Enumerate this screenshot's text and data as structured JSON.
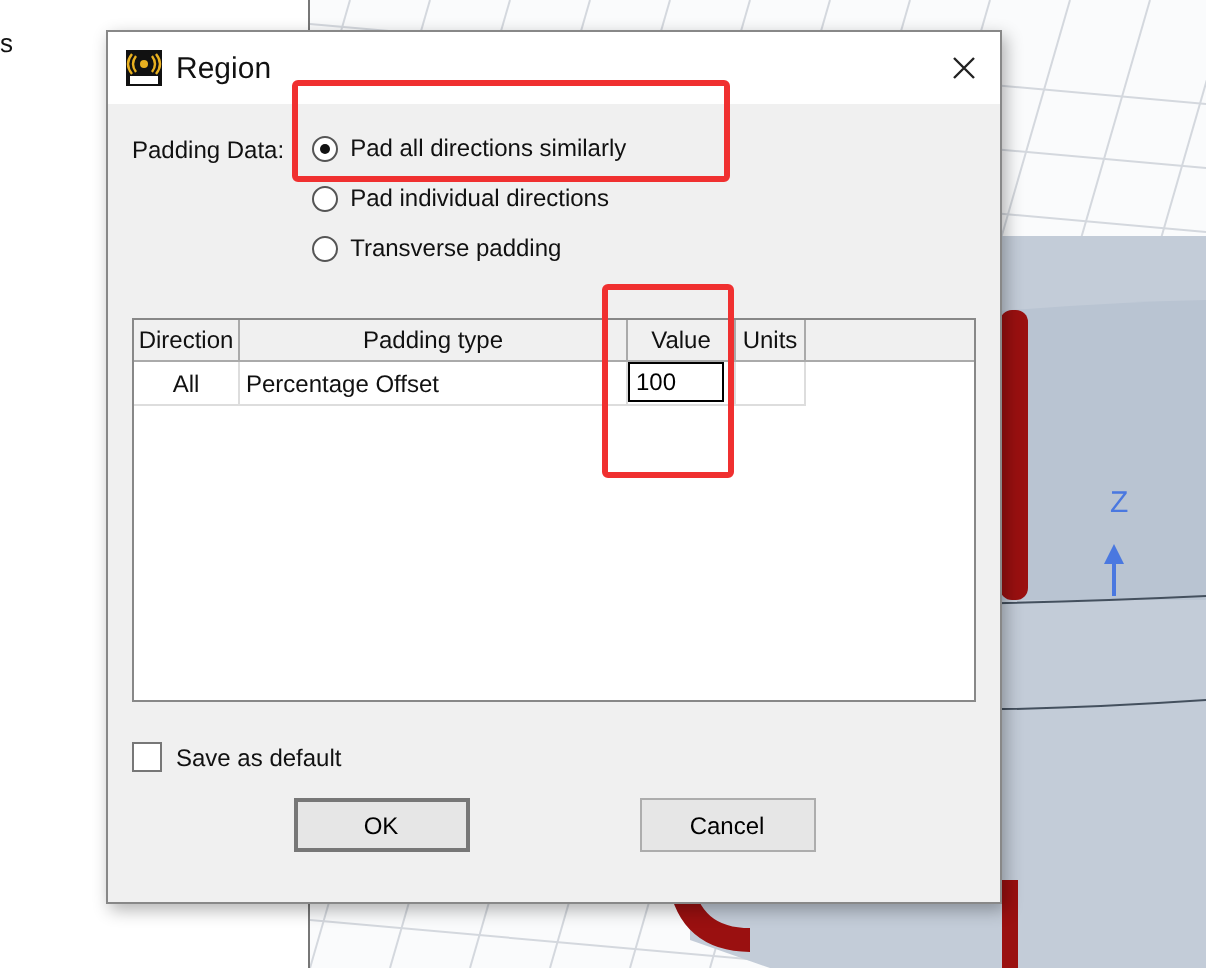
{
  "side_panel": {
    "text_fragment": "s"
  },
  "viewport": {
    "axis_label": "Z"
  },
  "dialog": {
    "title": "Region",
    "padding_label": "Padding Data:",
    "options": [
      {
        "label": "Pad all directions similarly",
        "selected": true
      },
      {
        "label": "Pad individual directions",
        "selected": false
      },
      {
        "label": "Transverse padding",
        "selected": false
      }
    ],
    "table": {
      "columns": [
        "Direction",
        "Padding type",
        "Value",
        "Units"
      ],
      "rows": [
        {
          "cells": [
            "All",
            "Percentage Offset",
            "100",
            ""
          ]
        }
      ]
    },
    "save_default": {
      "label": "Save as default",
      "checked": false
    },
    "buttons": [
      "OK",
      "Cancel"
    ]
  }
}
